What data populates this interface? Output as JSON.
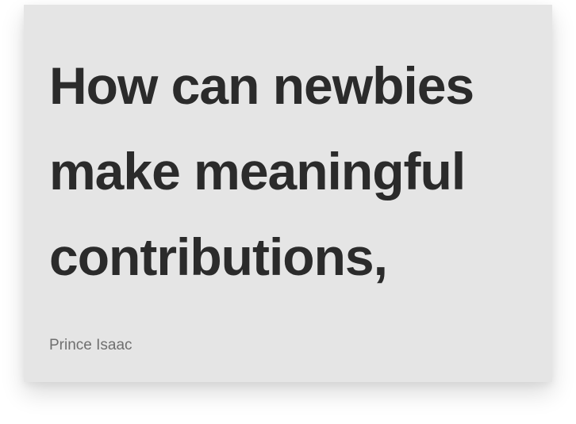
{
  "card": {
    "title": "How can newbies make meaningful contributions,",
    "author": "Prince Isaac"
  },
  "colors": {
    "card_background": "#e5e5e5",
    "title_text": "#2b2b2b",
    "author_text": "#6f6f6f"
  }
}
